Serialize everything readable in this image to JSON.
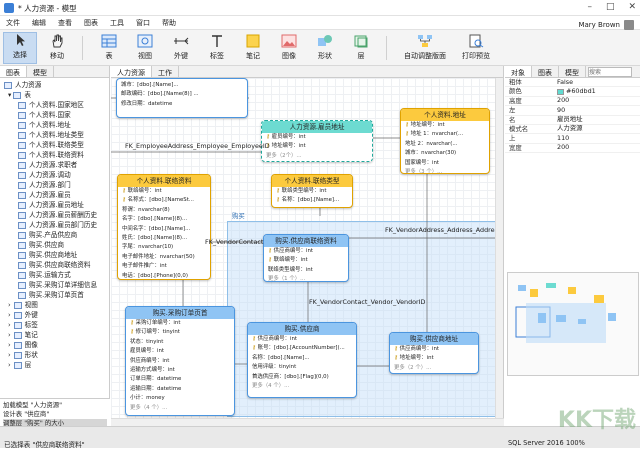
{
  "window": {
    "title": "* 人力资源 - 模型"
  },
  "menu": [
    "文件",
    "编辑",
    "查看",
    "图表",
    "工具",
    "窗口",
    "帮助"
  ],
  "user": {
    "name": "Mary Brown"
  },
  "toolbar": {
    "items": [
      {
        "label": "选择",
        "icon": "cursor-icon"
      },
      {
        "label": "移动",
        "icon": "hand-icon"
      },
      {
        "label": "表",
        "icon": "table-icon"
      },
      {
        "label": "视图",
        "icon": "view-icon"
      },
      {
        "label": "外键",
        "icon": "foreign-key-icon"
      },
      {
        "label": "标签",
        "icon": "text-icon"
      },
      {
        "label": "笔记",
        "icon": "note-icon"
      },
      {
        "label": "图像",
        "icon": "image-icon"
      },
      {
        "label": "形状",
        "icon": "shape-icon"
      },
      {
        "label": "层",
        "icon": "layer-icon"
      },
      {
        "label": "自动调整版面",
        "icon": "auto-layout-icon"
      },
      {
        "label": "打印预览",
        "icon": "print-preview-icon"
      }
    ]
  },
  "left_panel": {
    "tabs": [
      "图表",
      "模型"
    ],
    "root": "人力资源",
    "group": "表",
    "tables": [
      "个人资料.国家地区",
      "个人资料.国家",
      "个人资料.地址",
      "个人资料.地址类型",
      "个人资料.联络类型",
      "个人资料.联络资料",
      "人力资源.求职者",
      "人力资源.调动",
      "人力资源.部门",
      "人力资源.雇员",
      "人力资源.雇员地址",
      "人力资源.雇员薪酬历史",
      "人力资源.雇员部门历史",
      "购买.产品供应商",
      "购买.供应商",
      "购买.供应商地址",
      "购买.供应商联络资料",
      "购买.运输方式",
      "购买.采购订单详细信息",
      "购买.采购订单页首"
    ],
    "others": [
      "视图",
      "外键",
      "标签",
      "笔记",
      "图像",
      "形状",
      "层"
    ],
    "log": [
      "加载模型 \"人力资源\"",
      "设计表 \"供应商\"",
      "调整层 \"购买\" 的大小"
    ]
  },
  "canvas": {
    "tabs": [
      "人力资源",
      "工作"
    ],
    "group_label": "购买",
    "entities": {
      "top": {
        "fields": [
          "城市：[dbo].[Name]...",
          "邮政编码：[dbo].[Name(8)] ...",
          "修改日期：datetime"
        ]
      },
      "emp_addr": {
        "title": "人力资源.雇员地址",
        "fields": [
          "雇员编号：int",
          "地址编号：int",
          "更多（2个）..."
        ]
      },
      "addr": {
        "title": "个人资料.地址",
        "fields": [
          "地址编号：int",
          "地址 1：nvarchar(...",
          "地址 2：nvarchar(...",
          "城市：nvarchar(30)",
          "国家编号：int",
          "更多（3 个）..."
        ]
      },
      "contact": {
        "title": "个人资料.联络资料",
        "fields": [
          "联络编号：int",
          "名称式：[dbo].[NameSt...",
          "称谓：nvarchar(8)",
          "名字：[dbo].[Name](8)...",
          "中间名字：[dbo].[Name]...",
          "姓氏：[dbo].[Name](8)...",
          "字尾：nvarchar(10)",
          "电子邮件地址：nvarchar(50)",
          "电子邮件推广：int",
          "电话：[dbo].[Phone](0,0)",
          "更多（4 个）..."
        ]
      },
      "contact_type": {
        "title": "个人资料.联络类型",
        "fields": [
          "联络类型编号：int",
          "名称：[dbo].[Name]..."
        ]
      },
      "vendor_contact": {
        "title": "购买.供应商联络资料",
        "fields": [
          "供应商编号：int",
          "联络编号：int",
          "联络类型编号：int",
          "更多（1 个）..."
        ]
      },
      "po_header": {
        "title": "购买.采购订单页首",
        "fields": [
          "采购订单编号：int",
          "修订编号：tinyint",
          "状态：tinyint",
          "雇员编号：int",
          "供应商编号：int",
          "运输方式编号：int",
          "订单日期：datetime",
          "运输日期：datetime",
          "小计：money",
          "更多（4 个）..."
        ]
      },
      "vendor": {
        "title": "购买.供应商",
        "fields": [
          "供应商编号：int",
          "账号：[dbo].[AccountNumber](...",
          "名称：[dbo].[Name]...",
          "信用评级：tinyint",
          "首选供应商：[dbo].[Flag](0,0)",
          "更多（4 个）..."
        ]
      },
      "vendor_addr": {
        "title": "购买.供应商地址",
        "fields": [
          "供应商编号：int",
          "地址编号：int",
          "更多（2 个）..."
        ]
      }
    },
    "relations": [
      "FK_EmployeeAddress_Employee_EmployeeID",
      "FK_VendorContact",
      "FK_VendorAddress_Address_AddressID",
      "FK_VendorContact_Vendor_VendorID"
    ]
  },
  "right_panel": {
    "tabs": [
      "对象",
      "图表",
      "模型"
    ],
    "search_placeholder": "搜索",
    "props": [
      {
        "k": "粗体",
        "v": "False"
      },
      {
        "k": "颜色",
        "v": "#60dbd1",
        "swatch": "#60dbd1"
      },
      {
        "k": "高度",
        "v": "200"
      },
      {
        "k": "左",
        "v": "90"
      },
      {
        "k": "名",
        "v": "雇员地址"
      },
      {
        "k": "模式名",
        "v": "人力资源"
      },
      {
        "k": "上",
        "v": "110"
      },
      {
        "k": "宽度",
        "v": "200"
      }
    ]
  },
  "status": {
    "selection": "已选择表 \"供应商联络资料\"",
    "db": "SQL Server 2016",
    "zoom": "100%"
  },
  "watermark": "KK下载"
}
